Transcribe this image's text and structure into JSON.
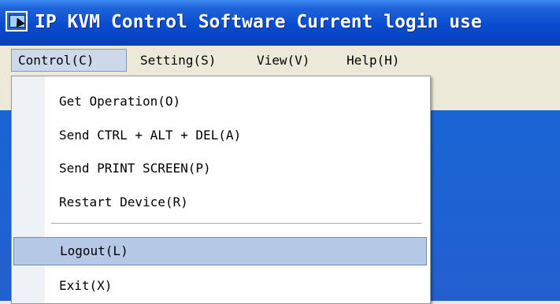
{
  "window": {
    "title": "IP KVM Control Software Current login use",
    "app_icon": "kvm-app-icon"
  },
  "menubar": {
    "items": [
      {
        "label": "Control(C)"
      },
      {
        "label": "Setting(S)"
      },
      {
        "label": "View(V)"
      },
      {
        "label": "Help(H)"
      }
    ]
  },
  "control_menu": {
    "items": [
      {
        "label": "Get Operation(O)"
      },
      {
        "label": "Send CTRL + ALT + DEL(A)"
      },
      {
        "label": "Send PRINT SCREEN(P)"
      },
      {
        "label": "Restart Device(R)"
      },
      {
        "label": "Logout(L)",
        "highlighted": true
      },
      {
        "label": "Exit(X)"
      }
    ]
  },
  "colors": {
    "titlebar": "#0a4bd0",
    "menu_highlight": "#b5c8e6",
    "client_background": "#1d63d2"
  }
}
